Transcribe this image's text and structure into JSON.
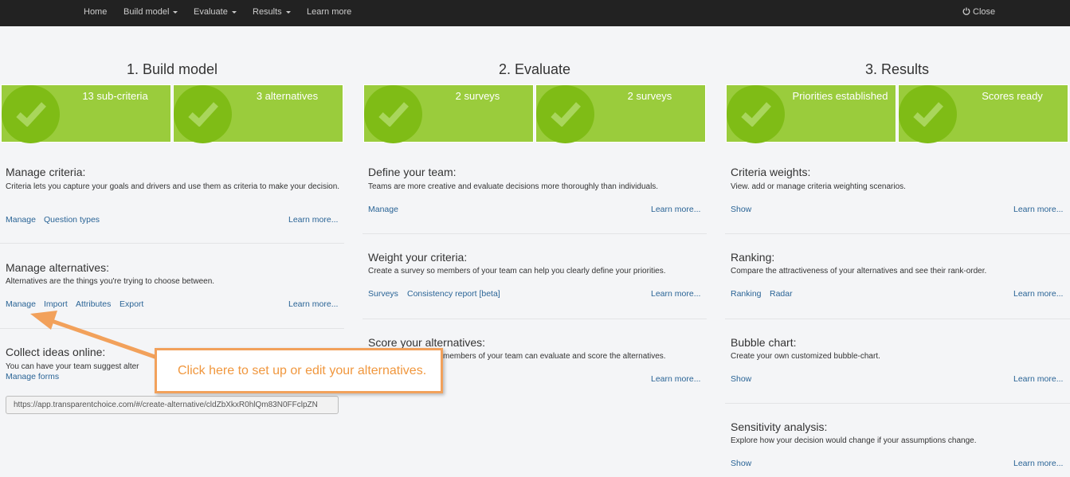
{
  "nav": {
    "items": [
      "Home",
      "Build model",
      "Evaluate",
      "Results",
      "Learn more"
    ],
    "close": "Close"
  },
  "columns": [
    {
      "title": "1. Build model",
      "tiles": [
        "13 sub-criteria",
        "3 alternatives"
      ],
      "sections": [
        {
          "title": "Manage criteria:",
          "desc": "Criteria lets you capture your goals and drivers and use them as criteria to make your decision.",
          "links": [
            "Manage",
            "Question types"
          ],
          "learn": "Learn more..."
        },
        {
          "title": "Manage alternatives:",
          "desc": "Alternatives are the things you're trying to choose between.",
          "links": [
            "Manage",
            "Import",
            "Attributes",
            "Export"
          ],
          "learn": "Learn more..."
        },
        {
          "title": "Collect ideas online:",
          "desc": "You can have your team suggest alter",
          "links": [
            "Manage forms"
          ],
          "url": "https://app.transparentchoice.com/#/create-alternative/cldZbXkxR0hlQm83N0FFclpZN"
        }
      ]
    },
    {
      "title": "2. Evaluate",
      "tiles": [
        "2 surveys",
        "2 surveys"
      ],
      "sections": [
        {
          "title": "Define your team:",
          "desc": "Teams are more creative and evaluate decisions more thoroughly than individuals.",
          "links": [
            "Manage"
          ],
          "learn": "Learn more..."
        },
        {
          "title": "Weight your criteria:",
          "desc": "Create a survey so members of your team can help you clearly define your priorities.",
          "links": [
            "Surveys",
            "Consistency report [beta]"
          ],
          "learn": "Learn more..."
        },
        {
          "title": "Score your alternatives:",
          "desc": "members of your team can evaluate and score the alternatives.",
          "learn": "Learn more..."
        }
      ]
    },
    {
      "title": "3. Results",
      "tiles": [
        "Priorities established",
        "Scores ready"
      ],
      "sections": [
        {
          "title": "Criteria weights:",
          "desc": "View. add or manage criteria weighting scenarios.",
          "links": [
            "Show"
          ],
          "learn": "Learn more..."
        },
        {
          "title": "Ranking:",
          "desc": "Compare the attractiveness of your alternatives and see their rank-order.",
          "links": [
            "Ranking",
            "Radar"
          ],
          "learn": "Learn more..."
        },
        {
          "title": "Bubble chart:",
          "desc": "Create your own customized bubble-chart.",
          "links": [
            "Show"
          ],
          "learn": "Learn more..."
        },
        {
          "title": "Sensitivity analysis:",
          "desc": "Explore how your decision would change if your assumptions change.",
          "links": [
            "Show"
          ],
          "learn": "Learn more..."
        }
      ]
    }
  ],
  "callout": {
    "text": "Click here to set up or edit your alternatives."
  },
  "colors": {
    "tile_green": "#9acc3c",
    "circle_green": "#7fbc16",
    "link_blue": "#2a6496",
    "callout_orange": "#f0973e",
    "navbar": "#222222"
  }
}
